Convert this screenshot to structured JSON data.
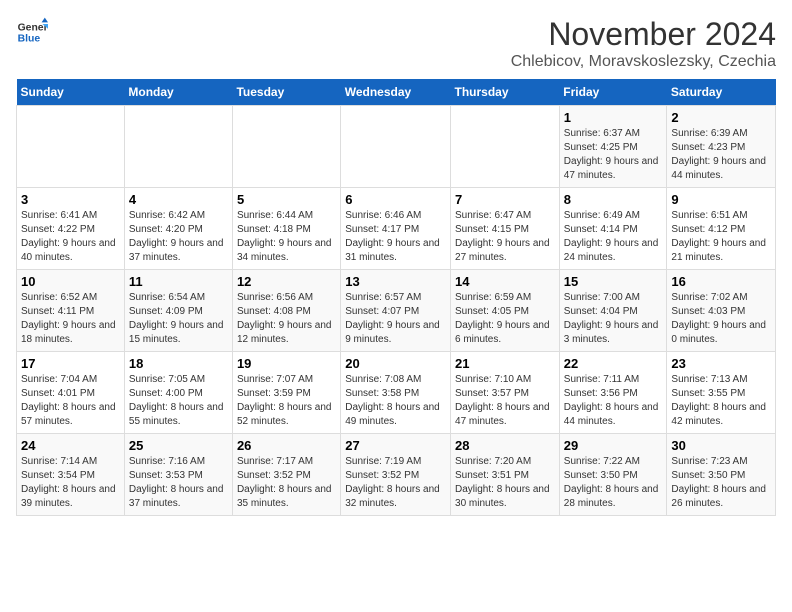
{
  "logo": {
    "line1": "General",
    "line2": "Blue"
  },
  "title": "November 2024",
  "location": "Chlebicov, Moravskoslezsky, Czechia",
  "weekdays": [
    "Sunday",
    "Monday",
    "Tuesday",
    "Wednesday",
    "Thursday",
    "Friday",
    "Saturday"
  ],
  "weeks": [
    [
      {
        "day": "",
        "info": ""
      },
      {
        "day": "",
        "info": ""
      },
      {
        "day": "",
        "info": ""
      },
      {
        "day": "",
        "info": ""
      },
      {
        "day": "",
        "info": ""
      },
      {
        "day": "1",
        "info": "Sunrise: 6:37 AM\nSunset: 4:25 PM\nDaylight: 9 hours\nand 47 minutes."
      },
      {
        "day": "2",
        "info": "Sunrise: 6:39 AM\nSunset: 4:23 PM\nDaylight: 9 hours\nand 44 minutes."
      }
    ],
    [
      {
        "day": "3",
        "info": "Sunrise: 6:41 AM\nSunset: 4:22 PM\nDaylight: 9 hours\nand 40 minutes."
      },
      {
        "day": "4",
        "info": "Sunrise: 6:42 AM\nSunset: 4:20 PM\nDaylight: 9 hours\nand 37 minutes."
      },
      {
        "day": "5",
        "info": "Sunrise: 6:44 AM\nSunset: 4:18 PM\nDaylight: 9 hours\nand 34 minutes."
      },
      {
        "day": "6",
        "info": "Sunrise: 6:46 AM\nSunset: 4:17 PM\nDaylight: 9 hours\nand 31 minutes."
      },
      {
        "day": "7",
        "info": "Sunrise: 6:47 AM\nSunset: 4:15 PM\nDaylight: 9 hours\nand 27 minutes."
      },
      {
        "day": "8",
        "info": "Sunrise: 6:49 AM\nSunset: 4:14 PM\nDaylight: 9 hours\nand 24 minutes."
      },
      {
        "day": "9",
        "info": "Sunrise: 6:51 AM\nSunset: 4:12 PM\nDaylight: 9 hours\nand 21 minutes."
      }
    ],
    [
      {
        "day": "10",
        "info": "Sunrise: 6:52 AM\nSunset: 4:11 PM\nDaylight: 9 hours\nand 18 minutes."
      },
      {
        "day": "11",
        "info": "Sunrise: 6:54 AM\nSunset: 4:09 PM\nDaylight: 9 hours\nand 15 minutes."
      },
      {
        "day": "12",
        "info": "Sunrise: 6:56 AM\nSunset: 4:08 PM\nDaylight: 9 hours\nand 12 minutes."
      },
      {
        "day": "13",
        "info": "Sunrise: 6:57 AM\nSunset: 4:07 PM\nDaylight: 9 hours\nand 9 minutes."
      },
      {
        "day": "14",
        "info": "Sunrise: 6:59 AM\nSunset: 4:05 PM\nDaylight: 9 hours\nand 6 minutes."
      },
      {
        "day": "15",
        "info": "Sunrise: 7:00 AM\nSunset: 4:04 PM\nDaylight: 9 hours\nand 3 minutes."
      },
      {
        "day": "16",
        "info": "Sunrise: 7:02 AM\nSunset: 4:03 PM\nDaylight: 9 hours\nand 0 minutes."
      }
    ],
    [
      {
        "day": "17",
        "info": "Sunrise: 7:04 AM\nSunset: 4:01 PM\nDaylight: 8 hours\nand 57 minutes."
      },
      {
        "day": "18",
        "info": "Sunrise: 7:05 AM\nSunset: 4:00 PM\nDaylight: 8 hours\nand 55 minutes."
      },
      {
        "day": "19",
        "info": "Sunrise: 7:07 AM\nSunset: 3:59 PM\nDaylight: 8 hours\nand 52 minutes."
      },
      {
        "day": "20",
        "info": "Sunrise: 7:08 AM\nSunset: 3:58 PM\nDaylight: 8 hours\nand 49 minutes."
      },
      {
        "day": "21",
        "info": "Sunrise: 7:10 AM\nSunset: 3:57 PM\nDaylight: 8 hours\nand 47 minutes."
      },
      {
        "day": "22",
        "info": "Sunrise: 7:11 AM\nSunset: 3:56 PM\nDaylight: 8 hours\nand 44 minutes."
      },
      {
        "day": "23",
        "info": "Sunrise: 7:13 AM\nSunset: 3:55 PM\nDaylight: 8 hours\nand 42 minutes."
      }
    ],
    [
      {
        "day": "24",
        "info": "Sunrise: 7:14 AM\nSunset: 3:54 PM\nDaylight: 8 hours\nand 39 minutes."
      },
      {
        "day": "25",
        "info": "Sunrise: 7:16 AM\nSunset: 3:53 PM\nDaylight: 8 hours\nand 37 minutes."
      },
      {
        "day": "26",
        "info": "Sunrise: 7:17 AM\nSunset: 3:52 PM\nDaylight: 8 hours\nand 35 minutes."
      },
      {
        "day": "27",
        "info": "Sunrise: 7:19 AM\nSunset: 3:52 PM\nDaylight: 8 hours\nand 32 minutes."
      },
      {
        "day": "28",
        "info": "Sunrise: 7:20 AM\nSunset: 3:51 PM\nDaylight: 8 hours\nand 30 minutes."
      },
      {
        "day": "29",
        "info": "Sunrise: 7:22 AM\nSunset: 3:50 PM\nDaylight: 8 hours\nand 28 minutes."
      },
      {
        "day": "30",
        "info": "Sunrise: 7:23 AM\nSunset: 3:50 PM\nDaylight: 8 hours\nand 26 minutes."
      }
    ]
  ]
}
